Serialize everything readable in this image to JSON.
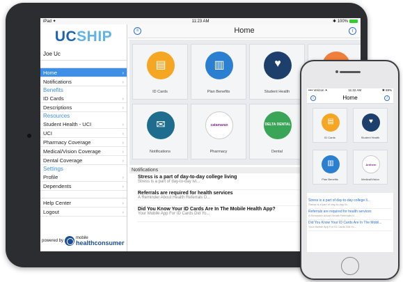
{
  "ipad": {
    "status": {
      "left": "iPad ✦",
      "time": "11:23 AM",
      "right": "✱ 100%"
    },
    "logo": {
      "uc": "UC",
      "ship": "SHIP"
    },
    "user": "Joe Uc",
    "nav": [
      {
        "type": "item",
        "label": "Home",
        "active": true
      },
      {
        "type": "item",
        "label": "Notifications"
      },
      {
        "type": "section",
        "label": "Benefits"
      },
      {
        "type": "item",
        "label": "ID Cards"
      },
      {
        "type": "item",
        "label": "Descriptions"
      },
      {
        "type": "section",
        "label": "Resources"
      },
      {
        "type": "item",
        "label": "Student Health - UCI"
      },
      {
        "type": "item",
        "label": "UCI"
      },
      {
        "type": "item",
        "label": "Pharmacy Coverage"
      },
      {
        "type": "item",
        "label": "Medical/Vision Coverage"
      },
      {
        "type": "item",
        "label": "Dental Coverage"
      },
      {
        "type": "section",
        "label": "Settings"
      },
      {
        "type": "item",
        "label": "Profile"
      },
      {
        "type": "item",
        "label": "Dependents"
      },
      {
        "type": "gap",
        "label": ""
      },
      {
        "type": "item",
        "label": "Help Center"
      },
      {
        "type": "item",
        "label": "Logout"
      }
    ],
    "powered": {
      "prefix": "powered by",
      "brand_top": "mobile",
      "brand_main": "healthconsumer"
    },
    "main_title": "Home",
    "tiles": [
      {
        "label": "ID Cards",
        "color": "#f5a623",
        "icon": "id-card-icon",
        "glyph": "▤"
      },
      {
        "label": "Plan Benefits",
        "color": "#2b7fd1",
        "icon": "document-icon",
        "glyph": "▥"
      },
      {
        "label": "Student Health",
        "color": "#1d3f6b",
        "icon": "heart-monitor-icon",
        "glyph": "♥"
      },
      {
        "label": "",
        "color": "#f07f3c",
        "icon": "care-hand-icon",
        "glyph": "♥"
      },
      {
        "label": "Notifications",
        "color": "#1e6c8e",
        "icon": "envelope-icon",
        "glyph": "✉"
      },
      {
        "label": "Pharmacy",
        "color": "#ffffff",
        "icon": "catamaran-logo",
        "glyph": "catamaran"
      },
      {
        "label": "Dental",
        "color": "#3aa557",
        "icon": "delta-dental-logo",
        "glyph": "DELTA DENTAL"
      }
    ],
    "notifications_header": "Notifications",
    "notifications": [
      {
        "title": "Stress is a part of day-to-day college living",
        "sub": "Stress is a part of day-to-day lvi..."
      },
      {
        "title": "Referrals are required for health services",
        "sub": "A Reminder About Health Referrals D..."
      },
      {
        "title": "Did You Know Your ID Cards Are In The Mobile Health App?",
        "sub": "Your Mobile App For ID Cards Did Yo..."
      }
    ]
  },
  "iphone": {
    "status": {
      "left": "•••• Verizon ✦",
      "time": "11:22 AM",
      "right": "✱ 69%"
    },
    "title": "Home",
    "tiles": [
      {
        "label": "ID Cards",
        "color": "#f5a623",
        "icon": "id-card-icon",
        "glyph": "▤"
      },
      {
        "label": "Student Health",
        "color": "#1d3f6b",
        "icon": "heart-monitor-icon",
        "glyph": "♥"
      },
      {
        "label": "Plan Benefits",
        "color": "#2b7fd1",
        "icon": "document-icon",
        "glyph": "▥"
      },
      {
        "label": "Medical/Vision",
        "color": "#ffffff",
        "icon": "anthem-logo",
        "glyph": "Anthem"
      }
    ],
    "notifications": [
      {
        "title": "Stress is a part of day-to-day college li...",
        "sub": "Stress is a part of day-to-day liv..."
      },
      {
        "title": "Referrals are required for health services",
        "sub": "A Reminder About Health Referrals D..."
      },
      {
        "title": "Did You Know Your ID Cards Are In The Mobil...",
        "sub": "Your Mobile App For ID Cards Did Yo..."
      }
    ]
  },
  "colors": {
    "accent": "#3e8fe5",
    "brand_dark": "#1c63b3",
    "brand_light": "#5fb3e6"
  }
}
